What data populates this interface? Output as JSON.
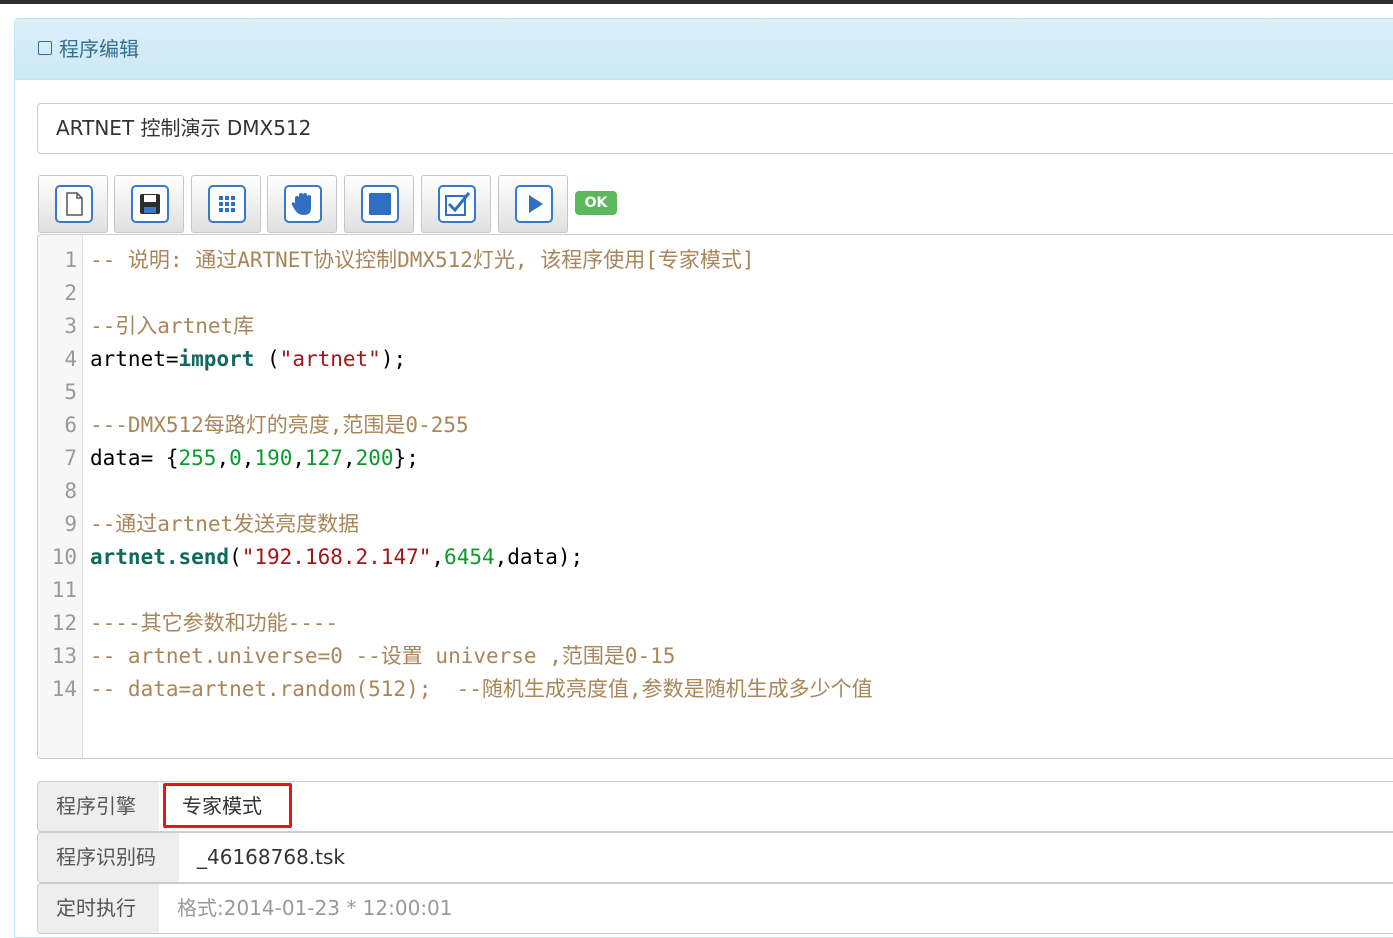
{
  "panel": {
    "title": "程序编辑"
  },
  "program": {
    "name": "ARTNET 控制演示 DMX512"
  },
  "toolbar": {
    "buttons": [
      {
        "name": "new-file-button",
        "icon": "file-icon"
      },
      {
        "name": "save-button",
        "icon": "floppy-disk-icon"
      },
      {
        "name": "grid-button",
        "icon": "grid-icon"
      },
      {
        "name": "hand-button",
        "icon": "hand-icon"
      },
      {
        "name": "stop-button",
        "icon": "stop-icon"
      },
      {
        "name": "check-button",
        "icon": "checkbox-icon"
      },
      {
        "name": "run-button",
        "icon": "play-icon"
      }
    ],
    "status": "OK",
    "status_color": "#5cb85c"
  },
  "editor": {
    "lines": [
      {
        "n": "1",
        "tokens": [
          {
            "t": "cm",
            "v": "-- 说明: 通过ARTNET协议控制DMX512灯光, 该程序使用[专家模式]"
          }
        ]
      },
      {
        "n": "2",
        "tokens": []
      },
      {
        "n": "3",
        "tokens": [
          {
            "t": "cm",
            "v": "--引入artnet库"
          }
        ]
      },
      {
        "n": "4",
        "tokens": [
          {
            "t": "tx",
            "v": "artnet="
          },
          {
            "t": "kw",
            "v": "import"
          },
          {
            "t": "tx",
            "v": " ("
          },
          {
            "t": "str",
            "v": "\"artnet\""
          },
          {
            "t": "tx",
            "v": ");"
          }
        ]
      },
      {
        "n": "5",
        "tokens": []
      },
      {
        "n": "6",
        "tokens": [
          {
            "t": "cm",
            "v": "---DMX512每路灯的亮度,范围是0-255"
          }
        ]
      },
      {
        "n": "7",
        "tokens": [
          {
            "t": "tx",
            "v": "data= {"
          },
          {
            "t": "num",
            "v": "255"
          },
          {
            "t": "tx",
            "v": ","
          },
          {
            "t": "num",
            "v": "0"
          },
          {
            "t": "tx",
            "v": ","
          },
          {
            "t": "num",
            "v": "190"
          },
          {
            "t": "tx",
            "v": ","
          },
          {
            "t": "num",
            "v": "127"
          },
          {
            "t": "tx",
            "v": ","
          },
          {
            "t": "num",
            "v": "200"
          },
          {
            "t": "tx",
            "v": "};"
          }
        ]
      },
      {
        "n": "8",
        "tokens": []
      },
      {
        "n": "9",
        "tokens": [
          {
            "t": "cm",
            "v": "--通过artnet发送亮度数据"
          }
        ]
      },
      {
        "n": "10",
        "tokens": [
          {
            "t": "kw",
            "v": "artnet.send"
          },
          {
            "t": "tx",
            "v": "("
          },
          {
            "t": "str",
            "v": "\"192.168.2.147\""
          },
          {
            "t": "tx",
            "v": ","
          },
          {
            "t": "num",
            "v": "6454"
          },
          {
            "t": "tx",
            "v": ",data);"
          }
        ]
      },
      {
        "n": "11",
        "tokens": []
      },
      {
        "n": "12",
        "tokens": [
          {
            "t": "cm",
            "v": "----其它参数和功能----"
          }
        ]
      },
      {
        "n": "13",
        "tokens": [
          {
            "t": "cm",
            "v": "-- artnet.universe=0 --设置 universe ,范围是0-15"
          }
        ]
      },
      {
        "n": "14",
        "tokens": [
          {
            "t": "cm",
            "v": "-- data=artnet.random(512);  --随机生成亮度值,参数是随机生成多少个值"
          }
        ]
      }
    ]
  },
  "form": {
    "engine_label": "程序引擎",
    "engine_value": "专家模式",
    "id_label": "程序识别码",
    "id_value": "_46168768.tsk",
    "timer_label": "定时执行",
    "timer_placeholder": "格式:2014-01-23 * 12:00:01"
  }
}
